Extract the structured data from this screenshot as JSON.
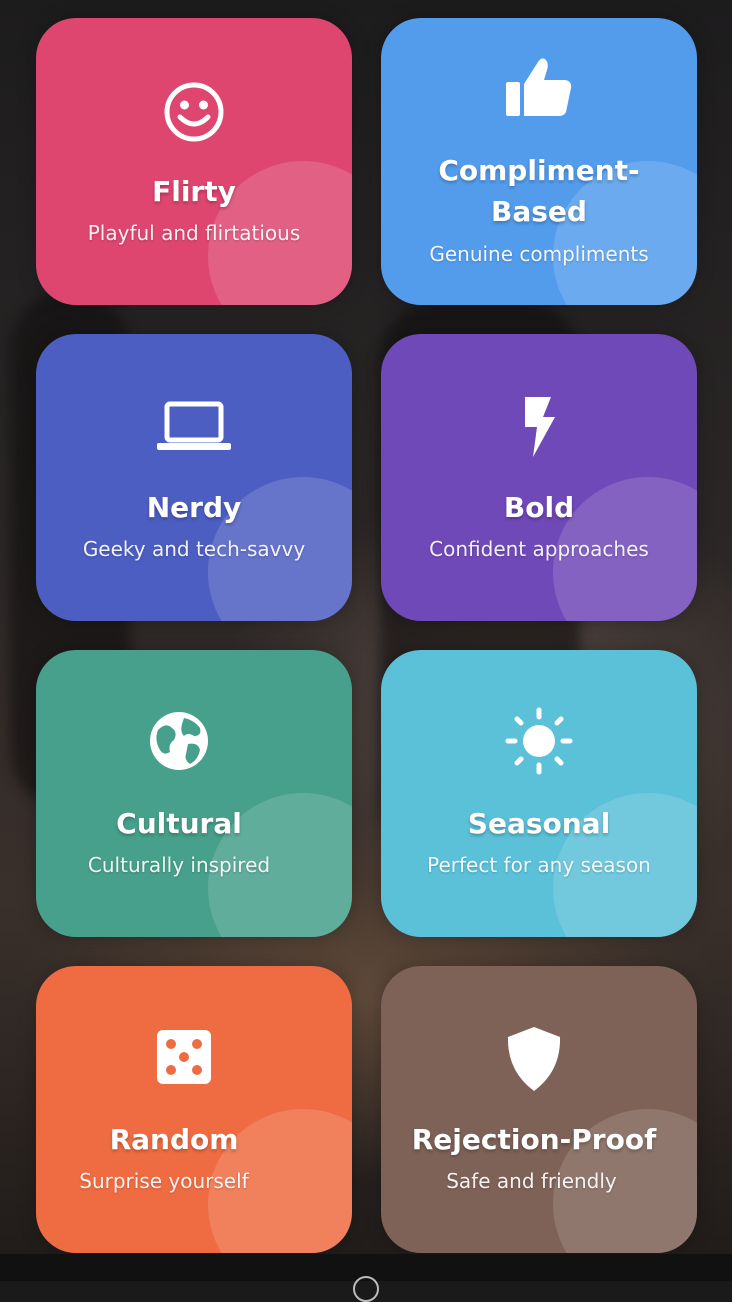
{
  "cards": [
    {
      "title": "Flirty",
      "subtitle": "Playful and flirtatious",
      "icon": "smiley-icon",
      "color": "#de4670"
    },
    {
      "title": "Compliment-\nBased",
      "subtitle": "Genuine compliments",
      "icon": "thumbs-up-icon",
      "color": "#539cec"
    },
    {
      "title": "Nerdy",
      "subtitle": "Geeky and tech-savvy",
      "icon": "laptop-icon",
      "color": "#4d5ec2"
    },
    {
      "title": "Bold",
      "subtitle": "Confident approaches",
      "icon": "lightning-bolt-icon",
      "color": "#7049b8"
    },
    {
      "title": "Cultural",
      "subtitle": "Culturally inspired",
      "icon": "globe-icon",
      "color": "#47a08c"
    },
    {
      "title": "Seasonal",
      "subtitle": "Perfect for any season",
      "icon": "sun-icon",
      "color": "#5bc1d9"
    },
    {
      "title": "Random",
      "subtitle": "Surprise yourself",
      "icon": "dice-icon",
      "color": "#ef6c43"
    },
    {
      "title": "Rejection-Proof",
      "subtitle": "Safe and friendly",
      "icon": "shield-icon",
      "color": "#7e6157"
    }
  ]
}
